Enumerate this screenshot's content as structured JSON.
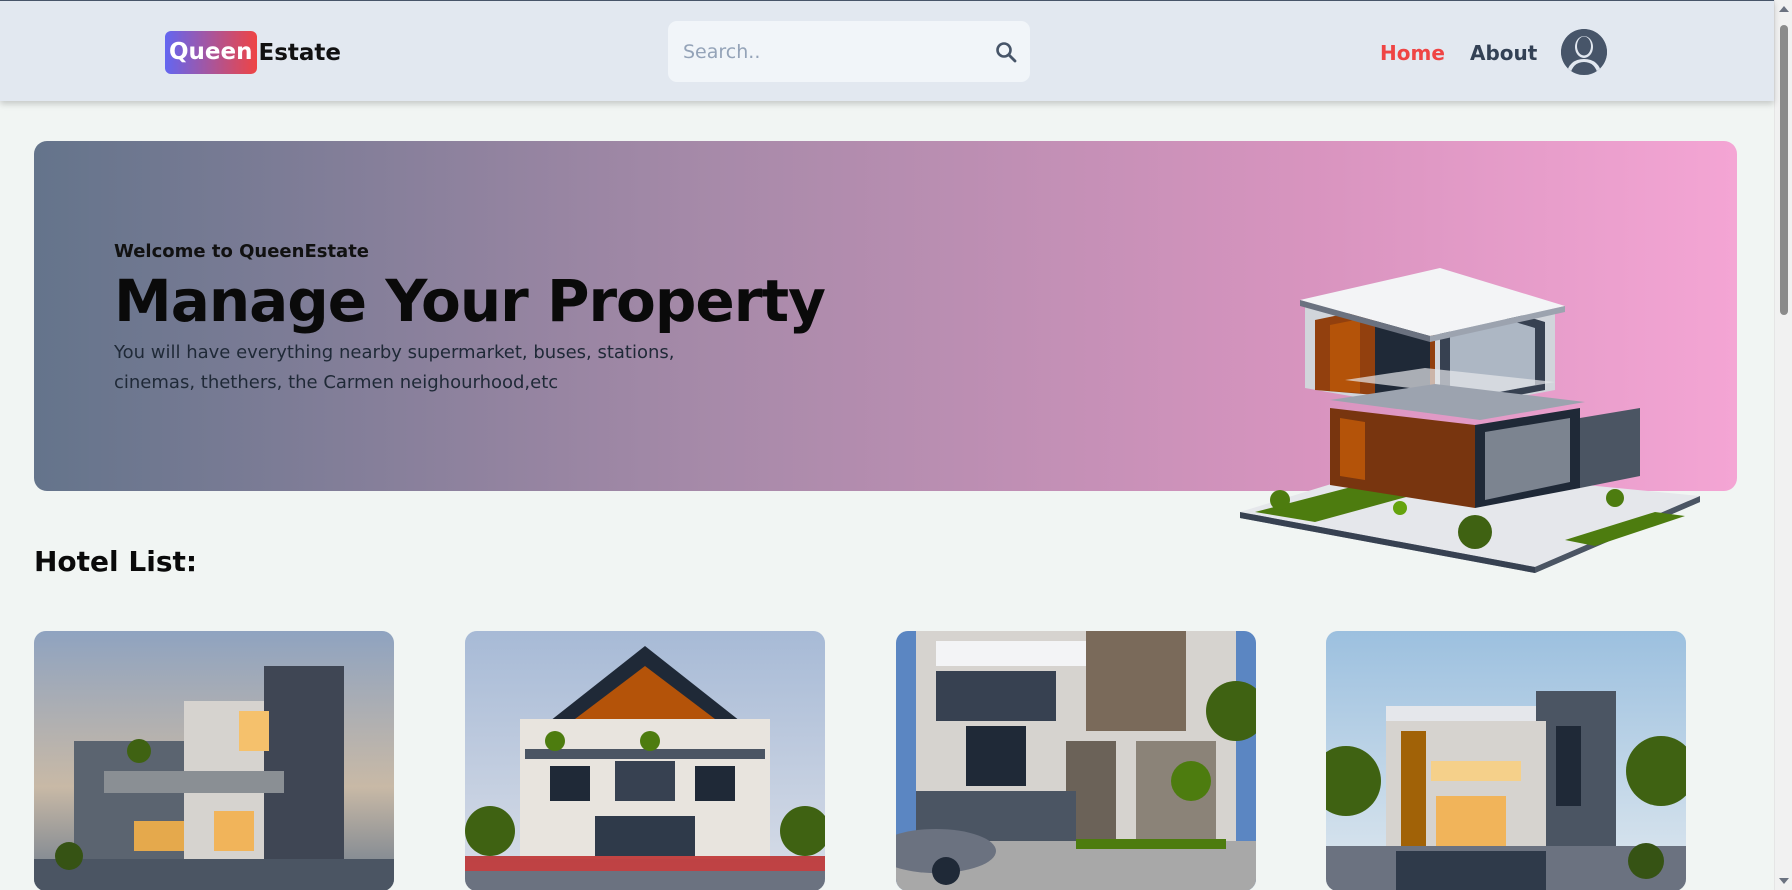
{
  "header": {
    "logo_part1": "Queen",
    "logo_part2": "Estate",
    "search_placeholder": "Search..",
    "nav": [
      {
        "label": "Home",
        "active": true
      },
      {
        "label": "About",
        "active": false
      }
    ],
    "accent_color": "#ef4444",
    "logo_gradient": [
      "#6366f1",
      "#ef4444"
    ]
  },
  "hero": {
    "welcome": "Welcome to QueenEstate",
    "title": "Manage Your Property",
    "description": "You will have everything nearby supermarket, buses, stations, cinemas, thethers, the Carmen neighourhood,etc",
    "gradient": [
      "#64748b",
      "#f4a5d4"
    ],
    "image_icon": "modern-house-illustration"
  },
  "hotel_list": {
    "title": "Hotel List:",
    "cards": [
      {
        "image_icon": "modern-villa-photo-1"
      },
      {
        "image_icon": "modern-villa-photo-2"
      },
      {
        "image_icon": "modern-villa-photo-3"
      },
      {
        "image_icon": "modern-villa-photo-4"
      }
    ]
  }
}
